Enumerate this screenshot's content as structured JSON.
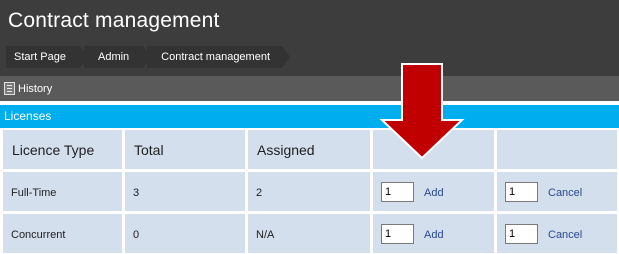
{
  "header": {
    "title": "Contract management",
    "breadcrumb": [
      "Start Page",
      "Admin",
      "Contract management"
    ]
  },
  "toolbar": {
    "history_label": "History",
    "history_icon": "document-icon"
  },
  "section": {
    "title": "Licenses"
  },
  "table": {
    "columns": [
      "Licence Type",
      "Total",
      "Assigned",
      "",
      ""
    ],
    "rows": [
      {
        "type": "Full-Time",
        "total": "3",
        "assigned": "2",
        "add_qty": "1",
        "add_label": "Add",
        "cancel_qty": "1",
        "cancel_label": "Cancel"
      },
      {
        "type": "Concurrent",
        "total": "0",
        "assigned": "N/A",
        "add_qty": "1",
        "add_label": "Add",
        "cancel_qty": "1",
        "cancel_label": "Cancel"
      }
    ]
  },
  "colors": {
    "header_bg": "#3d3d3d",
    "toolbar_bg": "#5a5a5a",
    "section_bg": "#00aeef",
    "cell_bg": "#d4dfee",
    "arrow_fill": "#c00000"
  }
}
